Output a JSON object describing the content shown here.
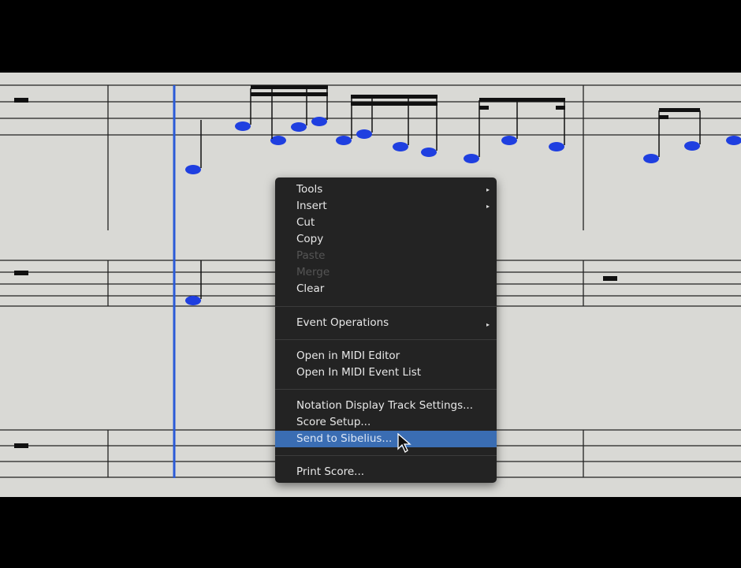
{
  "menu": {
    "items": [
      {
        "label": "Tools",
        "submenu": true
      },
      {
        "label": "Insert",
        "submenu": true
      },
      {
        "label": "Cut"
      },
      {
        "label": "Copy"
      },
      {
        "label": "Paste",
        "disabled": true
      },
      {
        "label": "Merge",
        "disabled": true
      },
      {
        "label": "Clear"
      },
      {
        "label": "Event Operations",
        "submenu": true
      },
      {
        "label": "Open in MIDI Editor"
      },
      {
        "label": "Open In MIDI Event List"
      },
      {
        "label": "Notation Display Track Settings..."
      },
      {
        "label": "Score Setup..."
      },
      {
        "label": "Send to Sibelius...",
        "highlighted": true
      },
      {
        "label": "Print Score..."
      }
    ],
    "submenu_arrow": "▸"
  },
  "colors": {
    "note": "#1f3fe0",
    "playhead": "#2a5ad8",
    "highlight": "#3a6db3",
    "menu_bg": "#232323",
    "score_bg": "#d9d9d5"
  }
}
